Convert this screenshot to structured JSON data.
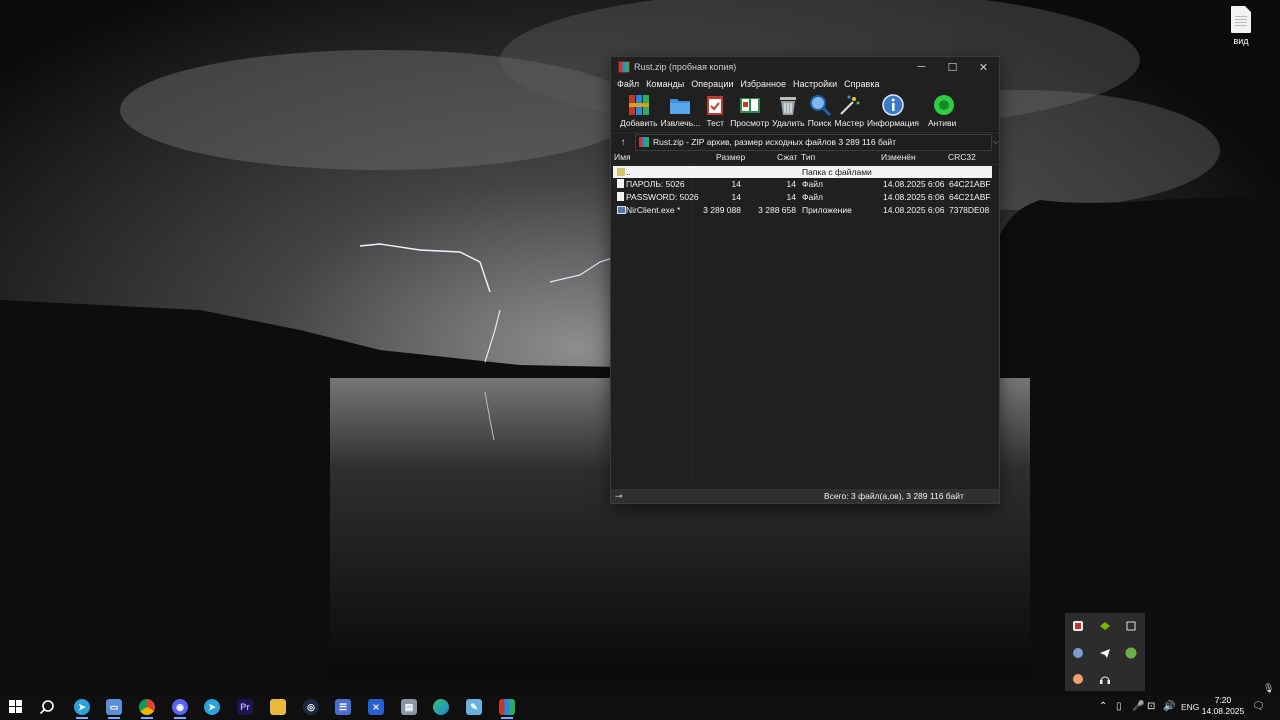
{
  "desktop": {
    "file_label": "вид"
  },
  "window": {
    "title": "Rust.zip (пробная копия)",
    "controls": {
      "minimize": "─",
      "maximize": "☐",
      "close": "✕"
    },
    "menu": [
      "Файл",
      "Команды",
      "Операции",
      "Избранное",
      "Настройки",
      "Справка"
    ],
    "toolbar": [
      {
        "label": "Добавить",
        "icon": "add-archive-icon"
      },
      {
        "label": "Извлечь...",
        "icon": "extract-folder-icon"
      },
      {
        "label": "Тест",
        "icon": "test-clipboard-icon"
      },
      {
        "label": "Просмотр",
        "icon": "view-book-icon"
      },
      {
        "label": "Удалить",
        "icon": "trash-icon"
      },
      {
        "label": "Поиск",
        "icon": "magnifier-icon"
      },
      {
        "label": "Мастер",
        "icon": "wizard-wand-icon"
      },
      {
        "label": "Информация",
        "icon": "info-icon"
      },
      {
        "label": "Антиви",
        "icon": "antivirus-icon"
      }
    ],
    "address": "Rust.zip - ZIP архив, размер исходных файлов 3 289 116 байт",
    "columns": {
      "name": "Имя",
      "size": "Размер",
      "packed": "Сжат",
      "type": "Тип",
      "modified": "Изменён",
      "crc": "CRC32"
    },
    "rows": [
      {
        "name": "..",
        "size": "",
        "packed": "",
        "type": "Папка с файлами",
        "modified": "",
        "crc": "",
        "icon": "folder"
      },
      {
        "name": "ПАРОЛЬ: 5026",
        "size": "14",
        "packed": "14",
        "type": "Файл",
        "modified": "14.08.2025 6:06",
        "crc": "64C21ABF",
        "icon": "file"
      },
      {
        "name": "PASSWORD: 5026",
        "size": "14",
        "packed": "14",
        "type": "Файл",
        "modified": "14.08.2025 6:06",
        "crc": "64C21ABF",
        "icon": "file"
      },
      {
        "name": "NirClient.exe *",
        "size": "3 289 088",
        "packed": "3 288 658",
        "type": "Приложение",
        "modified": "14.08.2025 6:06",
        "crc": "7378DE08",
        "icon": "exe"
      }
    ],
    "status": "Всего: 3 файл(а,ов), 3 289 116 байт"
  },
  "taskbar": {
    "apps": [
      "telegram-badge-icon",
      "window-app-icon",
      "chrome-icon",
      "discord-icon",
      "telegram-icon",
      "premiere-icon",
      "file-explorer-icon",
      "steam-icon",
      "app-icon",
      "visual-studio-icon",
      "folder-app-icon",
      "edge-icon",
      "notepad-icon",
      "winrar-icon"
    ],
    "language": "ENG",
    "time": "7:20",
    "date": "14.08.2025"
  }
}
